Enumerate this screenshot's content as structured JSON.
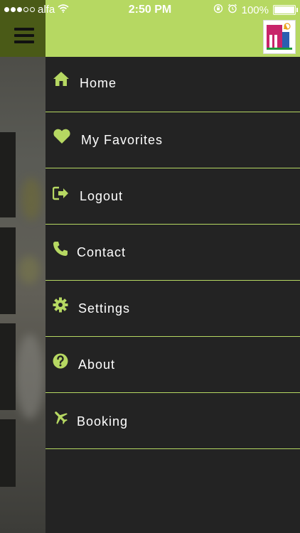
{
  "status_bar": {
    "carrier": "alfa",
    "time": "2:50 PM",
    "battery": "100%"
  },
  "menu": [
    {
      "label": "Home",
      "icon": "home-icon"
    },
    {
      "label": "My Favorites",
      "icon": "heart-icon"
    },
    {
      "label": "Logout",
      "icon": "sign-out-icon"
    },
    {
      "label": "Contact",
      "icon": "phone-icon"
    },
    {
      "label": "Settings",
      "icon": "gear-icon"
    },
    {
      "label": "About",
      "icon": "question-circle-icon"
    },
    {
      "label": "Booking",
      "icon": "airplane-icon"
    }
  ],
  "colors": {
    "accent": "#b6d862",
    "drawer_bg": "#232323",
    "topbar_left": "#4a5a17"
  }
}
